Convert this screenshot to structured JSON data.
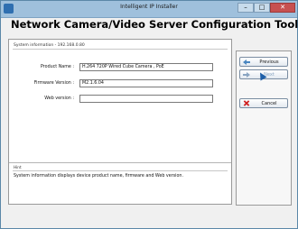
{
  "window": {
    "title": "Intelligent IP Installer",
    "controls": {
      "minimize": "–",
      "maximize": "□",
      "close": "✕"
    }
  },
  "header": {
    "title": "Network Camera/Video Server Configuration Tool"
  },
  "system_info": {
    "group_title": "System information - 192.168.0.80",
    "rows": [
      {
        "label": "Product Name :",
        "value": "H.264 720P Wired Cube Camera , PoE"
      },
      {
        "label": "Firmware Version :",
        "value": "M2.1.6.04"
      },
      {
        "label": "Web version :",
        "value": ""
      }
    ]
  },
  "hint": {
    "title": "Hint",
    "text": "System information displays device product name, firmware and Web version."
  },
  "buttons": {
    "previous": "Previous",
    "next": "Next",
    "cancel": "Cancel"
  },
  "colors": {
    "titlebar": "#9fc0dc",
    "close": "#c75050",
    "accent": "#2f6fb0"
  }
}
